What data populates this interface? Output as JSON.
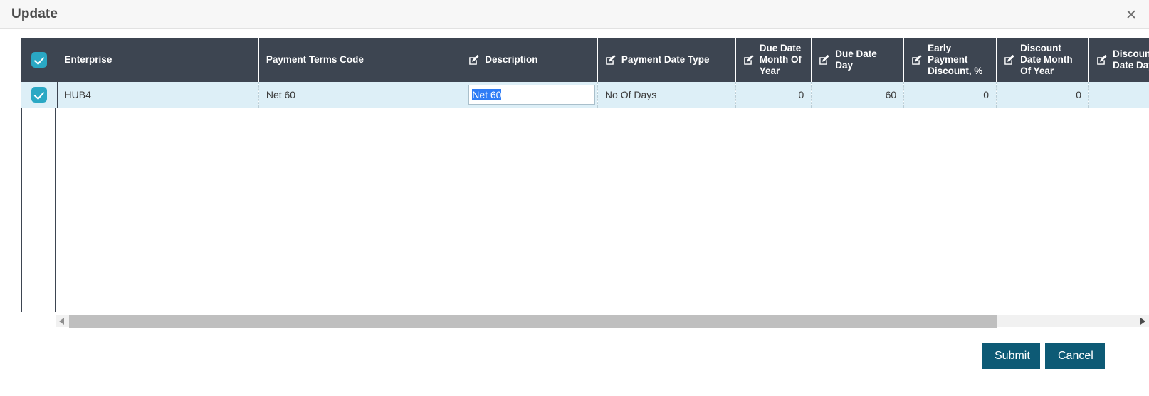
{
  "dialog": {
    "title": "Update",
    "close_icon": "close-icon"
  },
  "grid": {
    "select_all_icon": "checkbox-checked-icon",
    "edit_icon": "edit-pencil-icon",
    "columns": [
      {
        "label": "Enterprise",
        "editable": false,
        "align": "left"
      },
      {
        "label": "Payment Terms Code",
        "editable": false,
        "align": "left"
      },
      {
        "label": "Description",
        "editable": true,
        "align": "left"
      },
      {
        "label": "Payment Date Type",
        "editable": true,
        "align": "left"
      },
      {
        "label": "Due Date Month Of Year",
        "editable": true,
        "align": "right"
      },
      {
        "label": "Due Date Day",
        "editable": true,
        "align": "right"
      },
      {
        "label": "Early Payment Discount, %",
        "editable": true,
        "align": "right"
      },
      {
        "label": "Discount Date Month Of Year",
        "editable": true,
        "align": "right"
      },
      {
        "label": "Discount Date Day",
        "editable": true,
        "align": "right"
      }
    ],
    "rows": [
      {
        "selected": true,
        "enterprise": "HUB4",
        "payment_terms_code": "Net 60",
        "description": "Net 60",
        "payment_date_type": "No Of Days",
        "due_date_month_of_year": "0",
        "due_date_day": "60",
        "early_payment_discount_pct": "0",
        "discount_date_month_of_year": "0",
        "discount_date_day": ""
      }
    ],
    "active_editor": {
      "column": "Description",
      "value": "Net 60",
      "selected_text": "Net 60"
    }
  },
  "scrollbar": {
    "left_arrow_icon": "caret-left-icon",
    "right_arrow_icon": "caret-right-icon",
    "orientation": "horizontal"
  },
  "footer": {
    "submit_label": "Submit",
    "cancel_label": "Cancel"
  },
  "colors": {
    "header_bg": "#3d4551",
    "row_bg": "#ddeff7",
    "checkbox": "#2aa8c4",
    "link_text": "#2a7f9c",
    "button_bg": "#0d5a75",
    "selection": "#2f7df6",
    "titlebar_bg": "#f7f7f7"
  }
}
